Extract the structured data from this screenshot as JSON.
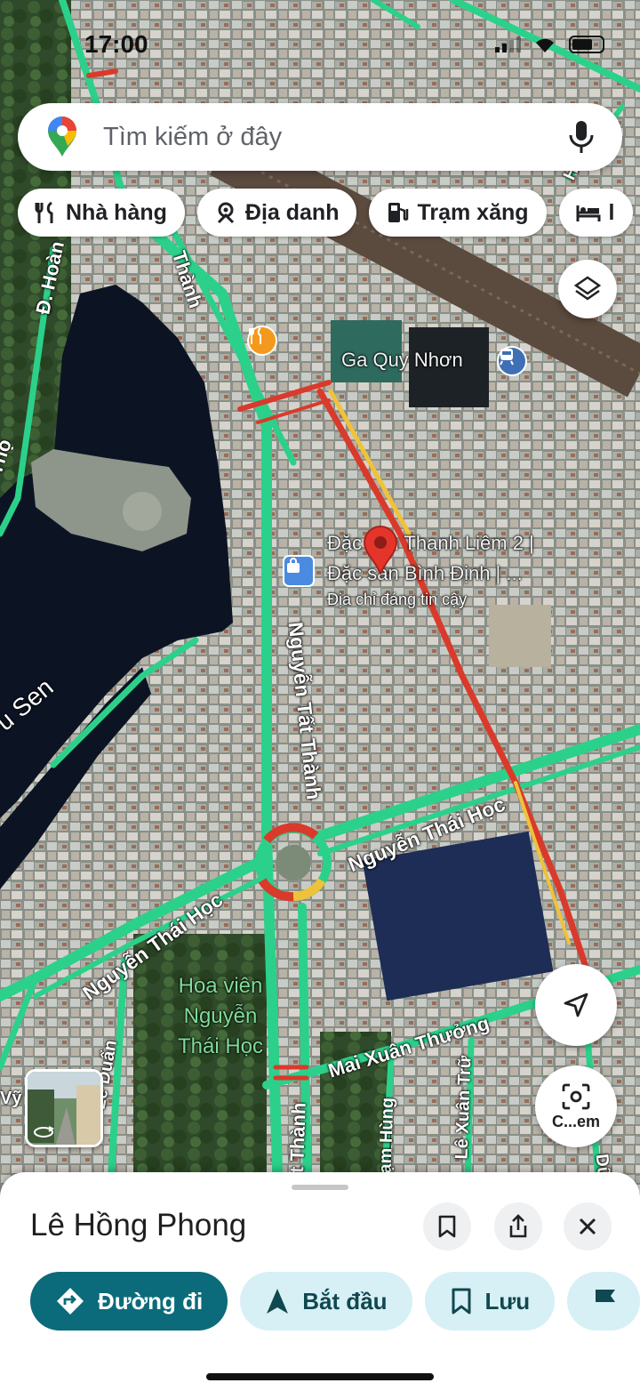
{
  "status_bar": {
    "time": "17:00"
  },
  "search": {
    "placeholder": "Tìm kiếm ở đây"
  },
  "chips": [
    {
      "label": "Nhà hàng",
      "icon": "restaurant-icon"
    },
    {
      "label": "Địa danh",
      "icon": "landmark-icon"
    },
    {
      "label": "Trạm xăng",
      "icon": "gas-station-icon"
    },
    {
      "label": "l",
      "icon": "hotel-icon"
    }
  ],
  "map": {
    "roads": {
      "hoang": "Đ. Hoàn",
      "tho": "Thọ",
      "thanh_top": "Thành",
      "nguyen_tat_thanh": "Nguyễn Tất Thành",
      "nguyen_thai_hoc_right": "Nguyễn Thái Học",
      "nguyen_thai_hoc_left": "Nguyễn Thái Học",
      "mai_xuan_thuong": "Mai Xuân Thưởng",
      "le_duan": "Lê Duẩn",
      "pham_hung": "ạm Hùng",
      "le_xuan_tru": "Lê Xuân Trữ",
      "thanh_bottom": "t Thành",
      "vy": "Vỹ",
      "ho_top": "Hồ",
      "sen": "u Sen",
      "dung": "Dũng"
    },
    "pois": {
      "station": "Ga Quy Nhơn",
      "shop_line1": "Đặc sản Thanh Liêm 2 |",
      "shop_line2": "Đặc sản Bình Định | ...",
      "shop_badge": "Địa chỉ đáng tin cậy",
      "park_line1": "Hoa viên",
      "park_line2": "Nguyễn",
      "park_line3": "Thái Học"
    }
  },
  "lens": {
    "label": "C...em"
  },
  "sheet": {
    "title": "Lê Hồng Phong",
    "actions": [
      {
        "label": "Đường đi",
        "icon": "directions-icon"
      },
      {
        "label": "Bắt đầu",
        "icon": "navigation-arrow-icon"
      },
      {
        "label": "Lưu",
        "icon": "bookmark-icon"
      },
      {
        "label": "",
        "icon": "flag-icon"
      }
    ]
  },
  "colors": {
    "traffic_green": "#2bd18a",
    "traffic_red": "#d93a2b",
    "traffic_yellow": "#f0c23a",
    "water": "#0c1424",
    "primary_action": "#0b6b7a",
    "secondary_action": "#d7f0f5",
    "pin": "#e5352b"
  }
}
